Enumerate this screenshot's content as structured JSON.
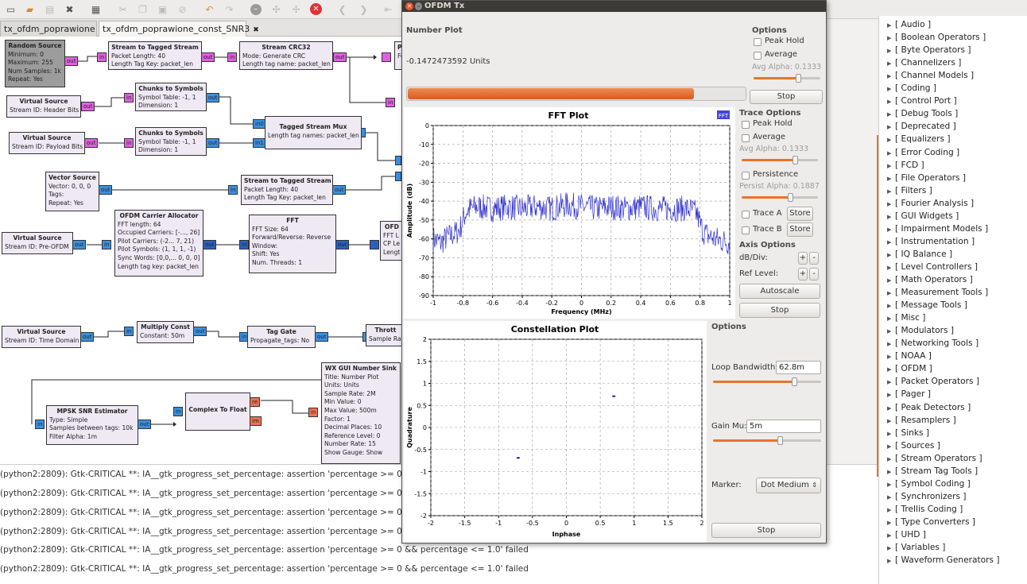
{
  "toolbar": {
    "icons": [
      "new-icon",
      "open-icon",
      "save-icon",
      "close-icon",
      "print-icon",
      "cut-icon",
      "copy-icon",
      "paste-icon",
      "delete-icon",
      "undo-icon",
      "redo-icon",
      "disable-icon",
      "bypass-icon",
      "enable-icon",
      "stop-icon",
      "back-icon",
      "forward-icon",
      "generate-icon"
    ]
  },
  "tabs": [
    {
      "label": "tx_ofdm_poprawione",
      "close": "✖"
    },
    {
      "label": "tx_ofdm_poprawione_const_SNR3",
      "close": "✖"
    }
  ],
  "blocks": {
    "random_source": {
      "title": "Random Source",
      "params": [
        "Minimum: 0",
        "Maximum: 255",
        "Num Samples: 1k",
        "Repeat: Yes"
      ],
      "out": "out"
    },
    "vs_header": {
      "title": "Virtual Source",
      "params": [
        "Stream ID: Header Bits"
      ],
      "out": "out"
    },
    "vs_payload": {
      "title": "Virtual Source",
      "params": [
        "Stream ID: Payload Bits"
      ],
      "out": "out"
    },
    "vector_source": {
      "title": "Vector Source",
      "params": [
        "Vector: 0, 0, 0",
        "Tags:",
        "Repeat: Yes"
      ],
      "out": "out"
    },
    "vs_preofdm": {
      "title": "Virtual Source",
      "params": [
        "Stream ID: Pre-OFDM"
      ],
      "out": "out"
    },
    "vs_timedomain": {
      "title": "Virtual Source",
      "params": [
        "Stream ID: Time Domain"
      ],
      "out": "out"
    },
    "stt1": {
      "title": "Stream to Tagged Stream",
      "params": [
        "Packet Length: 40",
        "Length Tag Key: packet_len"
      ],
      "in": "in",
      "out": "out"
    },
    "crc": {
      "title": "Stream CRC32",
      "params": [
        "Mode: Generate CRC",
        "Length tag name: packet_len"
      ],
      "in": "in",
      "out": "out"
    },
    "c2s1": {
      "title": "Chunks to Symbols",
      "params": [
        "Symbol Table: -1, 1",
        "Dimension: 1"
      ],
      "in": "in",
      "out": "out"
    },
    "c2s2": {
      "title": "Chunks to Symbols",
      "params": [
        "Symbol Table: -1, 1",
        "Dimension: 1"
      ],
      "in": "in",
      "out": "out"
    },
    "tsmux": {
      "title": "Tagged Stream Mux",
      "params": [
        "Length tag names: packet_len"
      ],
      "in0": "in0",
      "in1": "in1"
    },
    "stt2": {
      "title": "Stream to Tagged Stream",
      "params": [
        "Packet Length: 40",
        "Length Tag Key: packet_len"
      ],
      "in": "in",
      "out": "out"
    },
    "carrier": {
      "title": "OFDM Carrier Allocator",
      "params": [
        "FFT length: 64",
        "Occupied Carriers: [-..., 26]",
        "Pilot Carriers: (-2... 7, 21)",
        "Pilot Symbols: (1, 1, 1, -1)",
        "Sync Words: [0,0,... 0, 0, 0]",
        "Length tag key: packet_len"
      ],
      "in": "in",
      "out": "out"
    },
    "fft": {
      "title": "FFT",
      "params": [
        "FFT Size: 64",
        "Forward/Reverse: Reverse",
        "Window:",
        "Shift: Yes",
        "Num. Threads: 1"
      ],
      "in": "in",
      "out": "out"
    },
    "multiply": {
      "title": "Multiply Const",
      "params": [
        "Constant: 50m"
      ],
      "in": "in",
      "out": "out"
    },
    "taggate": {
      "title": "Tag Gate",
      "params": [
        "Propagate_tags: No"
      ],
      "in": "in",
      "out": "out"
    },
    "throttle": {
      "title": "Thrott",
      "params": [
        "Sample Rat"
      ],
      "in": "in"
    },
    "mpsk": {
      "title": "MPSK SNR Estimator",
      "params": [
        "Type: Simple",
        "Samples between tags: 10k",
        "Filter Alpha: 1m"
      ],
      "in": "in",
      "out": "out"
    },
    "c2f": {
      "title": "Complex To Float",
      "in": "in",
      "re": "re",
      "im": "im"
    },
    "wxsink": {
      "title": "WX GUI Number Sink",
      "params": [
        "Title: Number Plot",
        "Units: Units",
        "Sample Rate: 2M",
        "Min Value: 0",
        "Max Value: 500m",
        "Factor: 1",
        "Decimal Places: 10",
        "Reference Level: 0",
        "Number Rate: 15",
        "Show Gauge: Show"
      ],
      "in": "in"
    },
    "cut_p": {
      "title": "P",
      "params": [
        "Fe"
      ]
    },
    "cut_ofd": {
      "title": "OFD",
      "params": [
        "FFT L",
        "CP Le",
        "Lengt"
      ]
    }
  },
  "console": {
    "lines": [
      "(python2:2809): Gtk-CRITICAL **: IA__gtk_progress_set_percentage: assertion 'percentage >= 0 && percentag",
      "(python2:2809): Gtk-CRITICAL **: IA__gtk_progress_set_percentage: assertion 'percentage >= 0 && percentag",
      "(python2:2809): Gtk-CRITICAL **: IA__gtk_progress_set_percentage: assertion 'percentage >= 0 && percentag",
      "(python2:2809): Gtk-CRITICAL **: IA__gtk_progress_set_percentage: assertion 'percentage >= 0 && percentag",
      "(python2:2809): Gtk-CRITICAL **: IA__gtk_progress_set_percentage: assertion 'percentage >= 0 && percentage <= 1.0' failed",
      "(python2:2809): Gtk-CRITICAL **: IA__gtk_progress_set_percentage: assertion 'percentage >= 0 && percentage <= 1.0' failed"
    ]
  },
  "block_tree": {
    "items": [
      "[ Audio ]",
      "[ Boolean Operators ]",
      "[ Byte Operators ]",
      "[ Channelizers ]",
      "[ Channel Models ]",
      "[ Coding ]",
      "[ Control Port ]",
      "[ Debug Tools ]",
      "[ Deprecated ]",
      "[ Equalizers ]",
      "[ Error Coding ]",
      "[ FCD ]",
      "[ File Operators ]",
      "[ Filters ]",
      "[ Fourier Analysis ]",
      "[ GUI Widgets ]",
      "[ Impairment Models ]",
      "[ Instrumentation ]",
      "[ IQ Balance ]",
      "[ Level Controllers ]",
      "[ Math Operators ]",
      "[ Measurement Tools ]",
      "[ Message Tools ]",
      "[ Misc ]",
      "[ Modulators ]",
      "[ Networking Tools ]",
      "[ NOAA ]",
      "[ OFDM ]",
      "[ Packet Operators ]",
      "[ Pager ]",
      "[ Peak Detectors ]",
      "[ Resamplers ]",
      "[ Sinks ]",
      "[ Sources ]",
      "[ Stream Operators ]",
      "[ Stream Tag Tools ]",
      "[ Symbol Coding ]",
      "[ Synchronizers ]",
      "[ Trellis Coding ]",
      "[ Type Converters ]",
      "[ UHD ]",
      "[ Variables ]",
      "[ Waveform Generators ]"
    ],
    "arrow": "▶"
  },
  "window": {
    "title": "OFDM Tx",
    "number_plot": {
      "label": "Number Plot",
      "value": "-0.1472473592 Units",
      "gauge": 0.85,
      "options": {
        "title": "Options",
        "peak_hold": "Peak Hold",
        "average": "Average",
        "avg_alpha": "Avg Alpha: 0.1333",
        "stop": "Stop"
      }
    },
    "fft_plot": {
      "trace_options": "Trace Options",
      "peak_hold": "Peak Hold",
      "average": "Average",
      "avg_alpha": "Avg Alpha: 0.1333",
      "persistence": "Persistence",
      "persist_alpha": "Persist Alpha: 0.1887",
      "trace_a": "Trace A",
      "trace_b": "Trace B",
      "store": "Store",
      "axis_options": "Axis Options",
      "db_div": "dB/Div:",
      "ref_level": "Ref Level:",
      "plus": "+",
      "minus": "-",
      "autoscale": "Autoscale",
      "stop": "Stop"
    },
    "constellation": {
      "options": "Options",
      "loop_bw_label": "Loop Bandwidth:",
      "loop_bw": "62.8m",
      "gain_mu_label": "Gain Mu:",
      "gain_mu": "5m",
      "marker_label": "Marker:",
      "marker": "Dot Medium",
      "stop": "Stop"
    }
  },
  "chart_data": [
    {
      "type": "line",
      "title": "FFT Plot",
      "legend": "FFT",
      "xlabel": "Frequency (MHz)",
      "ylabel": "Amplitude (dB)",
      "xlim": [
        -1,
        1
      ],
      "ylim": [
        -90,
        0
      ],
      "xticks": [
        "-1",
        "-0.8",
        "-0.6",
        "-0.4",
        "-0.2",
        "0",
        "0.2",
        "0.4",
        "0.6",
        "0.8",
        "1"
      ],
      "yticks": [
        "0",
        "-10",
        "-20",
        "-30",
        "-40",
        "-50",
        "-60",
        "-70",
        "-80",
        "-90"
      ],
      "grid": true,
      "color": "#3333cc",
      "series": [
        {
          "x": [
            -1,
            -0.95,
            -0.9,
            -0.85,
            -0.82,
            -0.8,
            -0.78,
            -0.75,
            -0.7,
            -0.6,
            -0.5,
            -0.4,
            -0.3,
            -0.2,
            -0.1,
            0,
            0.1,
            0.2,
            0.3,
            0.4,
            0.5,
            0.6,
            0.7,
            0.75,
            0.78,
            0.8,
            0.82,
            0.85,
            0.9,
            0.95,
            1
          ],
          "y": [
            -60,
            -62,
            -59,
            -57,
            -55,
            -50,
            -46,
            -44,
            -43,
            -44,
            -43,
            -44,
            -43,
            -44,
            -42,
            -43,
            -44,
            -43,
            -44,
            -43,
            -44,
            -44,
            -44,
            -45,
            -47,
            -52,
            -56,
            -58,
            -60,
            -61,
            -62
          ]
        }
      ]
    },
    {
      "type": "scatter",
      "title": "Constellation Plot",
      "xlabel": "Inphase",
      "ylabel": "Quadrature",
      "xlim": [
        -2,
        2
      ],
      "ylim": [
        -2,
        2
      ],
      "xticks": [
        "-2",
        "-1.5",
        "-1",
        "-0.5",
        "0",
        "0.5",
        "1",
        "1.5",
        "2"
      ],
      "yticks": [
        "2",
        "1.5",
        "1",
        "0.5",
        "0",
        "-0.5",
        "-1",
        "-1.5",
        "-2"
      ],
      "grid": true,
      "color": "#0000aa",
      "series": [
        {
          "x": [
            0.7,
            -0.71
          ],
          "y": [
            0.71,
            -0.69
          ]
        }
      ]
    }
  ]
}
